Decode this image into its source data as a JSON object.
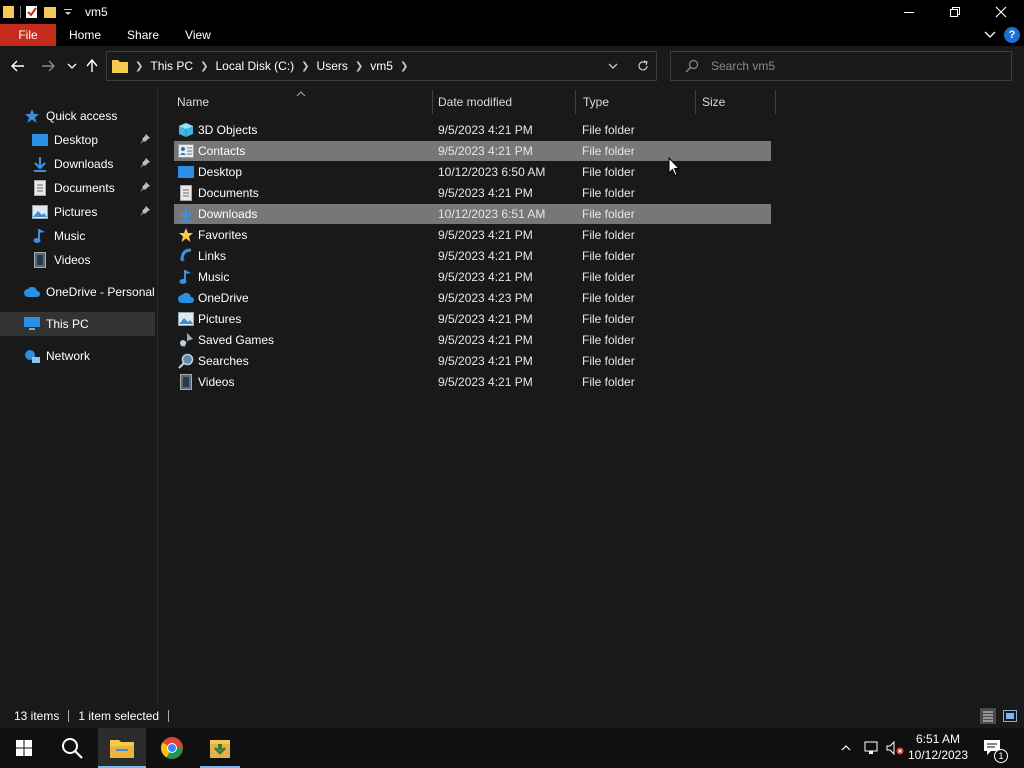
{
  "window": {
    "title": "vm5"
  },
  "ribbon": {
    "tabs": [
      "File",
      "Home",
      "Share",
      "View"
    ]
  },
  "address": {
    "crumbs": [
      "This PC",
      "Local Disk (C:)",
      "Users",
      "vm5"
    ]
  },
  "search": {
    "placeholder": "Search vm5"
  },
  "navpane": {
    "quick_access": "Quick access",
    "items": [
      {
        "label": "Desktop",
        "icon": "desktop-icon",
        "pinned": true
      },
      {
        "label": "Downloads",
        "icon": "download-icon",
        "pinned": true
      },
      {
        "label": "Documents",
        "icon": "document-icon",
        "pinned": true
      },
      {
        "label": "Pictures",
        "icon": "picture-icon",
        "pinned": true
      },
      {
        "label": "Music",
        "icon": "music-icon",
        "pinned": false
      },
      {
        "label": "Videos",
        "icon": "video-icon",
        "pinned": false
      }
    ],
    "onedrive": "OneDrive - Personal",
    "this_pc": "This PC",
    "network": "Network"
  },
  "columns": {
    "name": "Name",
    "date": "Date modified",
    "type": "Type",
    "size": "Size"
  },
  "files": [
    {
      "name": "3D Objects",
      "date": "9/5/2023 4:21 PM",
      "type": "File folder",
      "icon": "3d-objects-icon",
      "highlight": false
    },
    {
      "name": "Contacts",
      "date": "9/5/2023 4:21 PM",
      "type": "File folder",
      "icon": "contacts-icon",
      "highlight": true
    },
    {
      "name": "Desktop",
      "date": "10/12/2023 6:50 AM",
      "type": "File folder",
      "icon": "desktop-icon",
      "highlight": false
    },
    {
      "name": "Documents",
      "date": "9/5/2023 4:21 PM",
      "type": "File folder",
      "icon": "document-icon",
      "highlight": false
    },
    {
      "name": "Downloads",
      "date": "10/12/2023 6:51 AM",
      "type": "File folder",
      "icon": "download-icon",
      "highlight": true
    },
    {
      "name": "Favorites",
      "date": "9/5/2023 4:21 PM",
      "type": "File folder",
      "icon": "star-icon",
      "highlight": false
    },
    {
      "name": "Links",
      "date": "9/5/2023 4:21 PM",
      "type": "File folder",
      "icon": "link-icon",
      "highlight": false
    },
    {
      "name": "Music",
      "date": "9/5/2023 4:21 PM",
      "type": "File folder",
      "icon": "music-icon",
      "highlight": false
    },
    {
      "name": "OneDrive",
      "date": "9/5/2023 4:23 PM",
      "type": "File folder",
      "icon": "cloud-icon",
      "highlight": false
    },
    {
      "name": "Pictures",
      "date": "9/5/2023 4:21 PM",
      "type": "File folder",
      "icon": "picture-icon",
      "highlight": false
    },
    {
      "name": "Saved Games",
      "date": "9/5/2023 4:21 PM",
      "type": "File folder",
      "icon": "saved-games-icon",
      "highlight": false
    },
    {
      "name": "Searches",
      "date": "9/5/2023 4:21 PM",
      "type": "File folder",
      "icon": "search-icon",
      "highlight": false
    },
    {
      "name": "Videos",
      "date": "9/5/2023 4:21 PM",
      "type": "File folder",
      "icon": "video-icon",
      "highlight": false
    }
  ],
  "status": {
    "count": "13 items",
    "selection": "1 item selected"
  },
  "clock": {
    "time": "6:51 AM",
    "date": "10/12/2023"
  },
  "notifications": {
    "count": "1"
  },
  "colors": {
    "accent": "#76b9ed",
    "file_tab": "#c42b1c",
    "folder": "#f3c94f",
    "highlight_row": "#777777"
  }
}
